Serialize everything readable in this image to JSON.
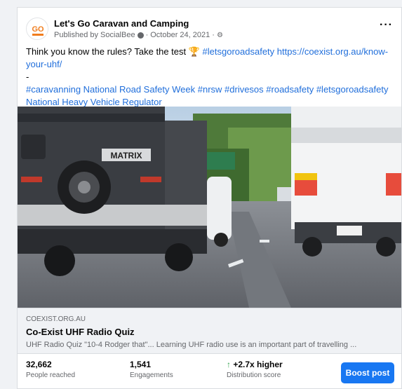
{
  "post": {
    "page_name": "Let's Go Caravan and Camping",
    "published_by": "Published by SocialBee",
    "date": "October 24, 2021",
    "more_icon": "ellipsis-icon",
    "text_line1": "Think you know the rules? Take the test ",
    "trophy": "🏆",
    "hashtag_safety": "#letsgoroadsafety",
    "url": "https://coexist.org.au/know-your-uhf/",
    "dash": "-",
    "hashtags": "#caravanning National Road Safety Week #nrsw #drivesos #roadsafety #letsgoroadsafety",
    "regulator": "National Heavy Vehicle Regulator"
  },
  "link_preview": {
    "domain": "COEXIST.ORG.AU",
    "title": "Co-Exist UHF Radio Quiz",
    "description": "UHF Radio Quiz \"10-4 Rodger that\"... Learning UHF radio use is an important part of travelling ...",
    "image_text": "MATRIX"
  },
  "stats": {
    "reached_value": "32,662",
    "reached_label": "People reached",
    "engagements_value": "1,541",
    "engagements_label": "Engagements",
    "distribution_value": "+2.7x higher",
    "distribution_label": "Distribution score",
    "boost_label": "Boost post"
  },
  "colors": {
    "link": "#216fdb",
    "boost": "#1877f2",
    "up": "#31a24c"
  }
}
